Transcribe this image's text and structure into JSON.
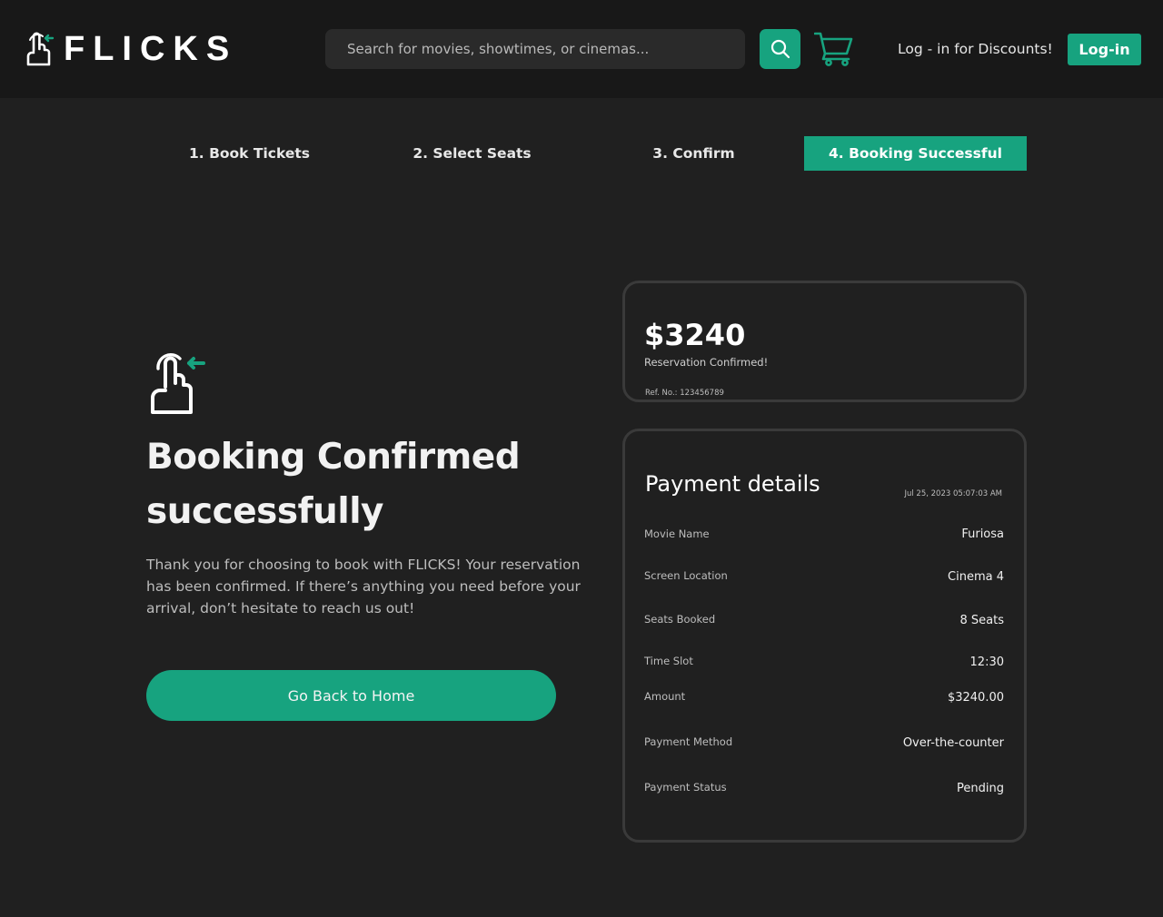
{
  "header": {
    "brand": "FLICKS",
    "search_placeholder": "Search for movies, showtimes, or cinemas...",
    "login_prompt": "Log - in for Discounts!",
    "login_button": "Log-in"
  },
  "steps": [
    {
      "label": "1. Book Tickets",
      "active": false
    },
    {
      "label": "2. Select Seats",
      "active": false
    },
    {
      "label": "3. Confirm",
      "active": false
    },
    {
      "label": "4. Booking Successful",
      "active": true
    }
  ],
  "hero": {
    "title_line1": "Booking Confirmed",
    "title_line2": "successfully",
    "description": "Thank you for choosing to book with FLICKS! Your reservation has been confirmed. If there’s anything you need before your arrival, don’t hesitate to reach us out!",
    "home_button": "Go Back to Home"
  },
  "summary": {
    "amount": "$3240",
    "status": "Reservation Confirmed!",
    "ref": "Ref. No.: 123456789"
  },
  "payment": {
    "title": "Payment details",
    "date": "Jul 25, 2023 05:07:03 AM",
    "rows": [
      {
        "label": "Movie Name",
        "value": "Furiosa"
      },
      {
        "label": "Screen Location",
        "value": "Cinema 4"
      },
      {
        "label": "Seats Booked",
        "value": "8 Seats"
      },
      {
        "label": "Time Slot",
        "value": "12:30"
      },
      {
        "label": "Amount",
        "value": "$3240.00"
      },
      {
        "label": "Payment Method",
        "value": "Over-the-counter"
      },
      {
        "label": "Payment Status",
        "value": "Pending"
      }
    ]
  },
  "colors": {
    "accent": "#17a37f",
    "background": "#202020",
    "header_bg": "#181818"
  },
  "icons": [
    "logo-hand-icon",
    "search-icon",
    "cart-icon",
    "hand-tap-icon"
  ]
}
